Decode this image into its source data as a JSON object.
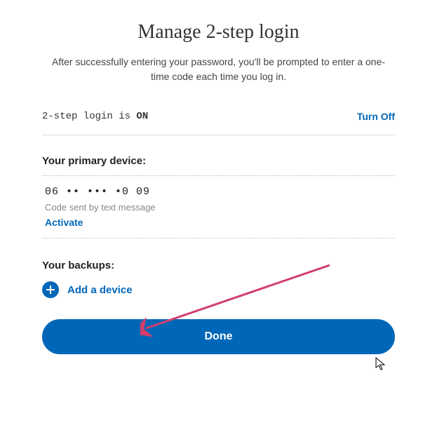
{
  "title": "Manage 2-step login",
  "subtitle": "After successfully entering your password, you'll be prompted to enter a one-time code each time you log in.",
  "status": {
    "prefix": "2-step login is ",
    "state": "ON",
    "turnoff_label": "Turn Off"
  },
  "primary": {
    "header": "Your primary device:",
    "phone": "06 •• ••• •0 09",
    "method": "Code sent by text message",
    "activate_label": "Activate"
  },
  "backups": {
    "header": "Your backups:",
    "add_label": "Add a device"
  },
  "done_label": "Done"
}
